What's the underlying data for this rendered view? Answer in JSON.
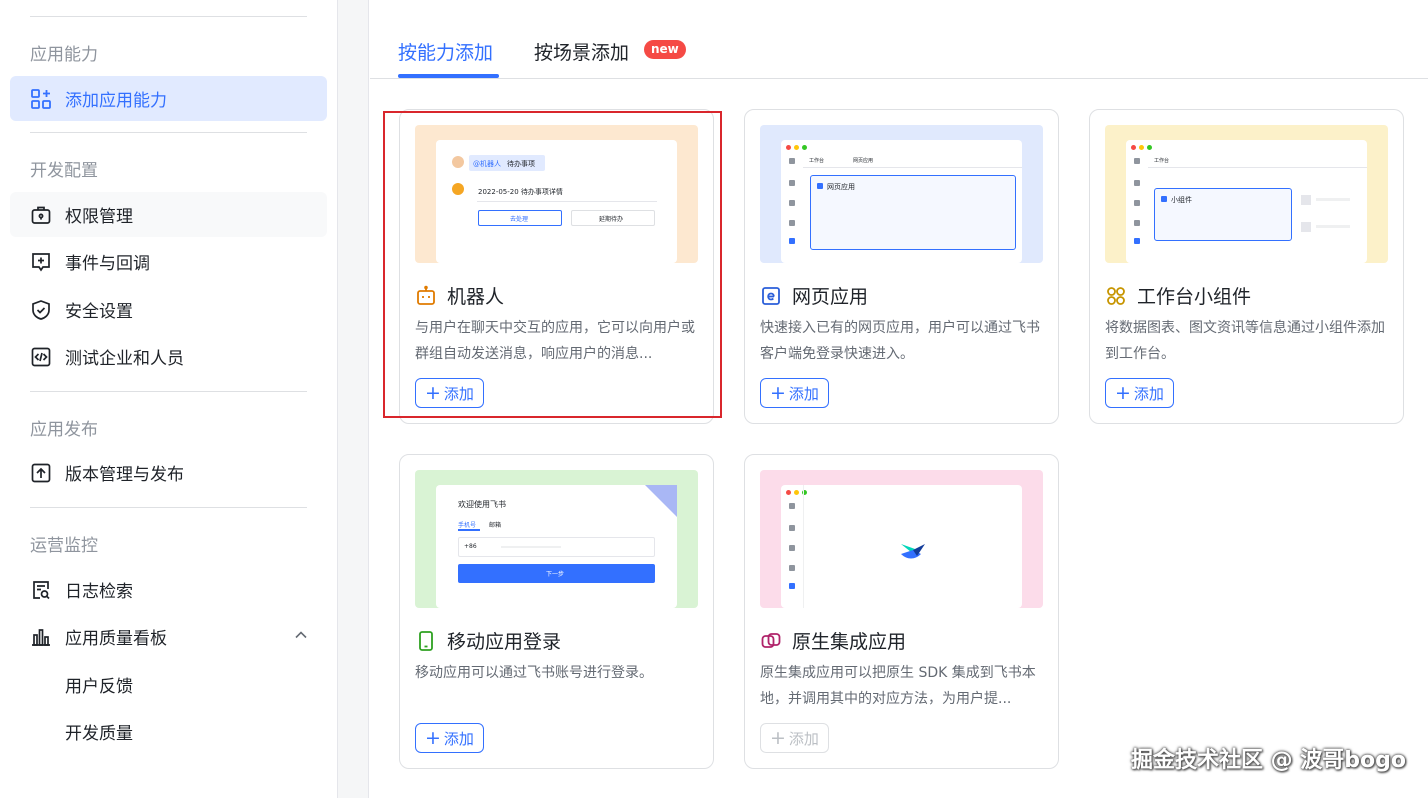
{
  "sidebar": {
    "sections": [
      {
        "title": "应用能力"
      },
      {
        "title": "开发配置"
      },
      {
        "title": "应用发布"
      },
      {
        "title": "运营监控"
      }
    ],
    "items": [
      {
        "label": "添加应用能力",
        "icon": "grid-plus-icon",
        "active": true
      },
      {
        "label": "权限管理",
        "icon": "lock-briefcase-icon"
      },
      {
        "label": "事件与回调",
        "icon": "event-plus-icon"
      },
      {
        "label": "安全设置",
        "icon": "shield-check-icon"
      },
      {
        "label": "测试企业和人员",
        "icon": "code-box-icon"
      },
      {
        "label": "版本管理与发布",
        "icon": "upload-box-icon"
      },
      {
        "label": "日志检索",
        "icon": "log-search-icon"
      },
      {
        "label": "应用质量看板",
        "icon": "bar-chart-icon"
      },
      {
        "label": "用户反馈"
      },
      {
        "label": "开发质量"
      }
    ]
  },
  "tabs": [
    {
      "label": "按能力添加",
      "active": true
    },
    {
      "label": "按场景添加",
      "badge": "new"
    }
  ],
  "cards": [
    {
      "title": "机器人",
      "icon": "robot-icon",
      "desc": "与用户在聊天中交互的应用，它可以向用户或群组自动发送消息，响应用户的消息...",
      "add_label": "添加",
      "thumb": {
        "tag": "@机器人",
        "tag2": "待办事项",
        "date_line": "2022-05-20 待办事项详情",
        "btn1": "去处理",
        "btn2": "延期待办"
      }
    },
    {
      "title": "网页应用",
      "icon": "web-e-icon",
      "desc": "快速接入已有的网页应用，用户可以通过飞书客户端免登录快速进入。",
      "add_label": "添加",
      "thumb": {
        "tab1": "工作台",
        "tab2": "网页应用",
        "panel": "网页应用"
      }
    },
    {
      "title": "工作台小组件",
      "icon": "widget-icon",
      "desc": "将数据图表、图文资讯等信息通过小组件添加到工作台。",
      "add_label": "添加",
      "thumb": {
        "tab1": "工作台",
        "panel": "小组件"
      }
    },
    {
      "title": "移动应用登录",
      "icon": "mobile-icon",
      "desc": "移动应用可以通过飞书账号进行登录。",
      "add_label": "添加",
      "thumb": {
        "welcome": "欢迎使用飞书",
        "tab_phone": "手机号",
        "tab_mail": "邮箱",
        "code": "+86",
        "next": "下一步"
      }
    },
    {
      "title": "原生集成应用",
      "icon": "native-link-icon",
      "desc": "原生集成应用可以把原生 SDK 集成到飞书本地，并调用其中的对应方法，为用户提...",
      "add_label": "添加",
      "disabled": true
    }
  ],
  "watermark": "掘金技术社区 @ 波哥bogo",
  "colors": {
    "accent": "#3370ff",
    "highlight": "#d9262c"
  }
}
